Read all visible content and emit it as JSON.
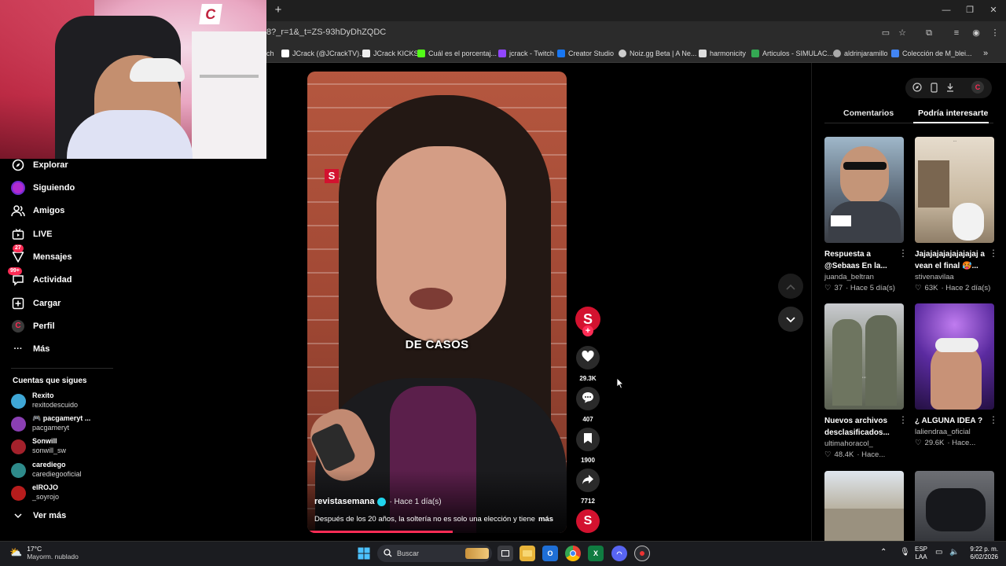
{
  "browser": {
    "url": "8?_r=1&_t=ZS-93hDyDhZQDC",
    "bookmarks": [
      {
        "label": "ch",
        "color": "#888888"
      },
      {
        "label": "JCrack (@JCrackTV)...",
        "color": "#ffffff"
      },
      {
        "label": "JCrack KICKS",
        "color": "#eeeeee"
      },
      {
        "label": "Cuál es el porcentaj...",
        "color": "#53fc18"
      },
      {
        "label": "jcrack - Twitch",
        "color": "#9146ff"
      },
      {
        "label": "Creator Studio",
        "color": "#1877f2"
      },
      {
        "label": "Noiz.gg Beta | A Ne...",
        "color": "#cccccc"
      },
      {
        "label": "harmonicity",
        "color": "#dddddd"
      },
      {
        "label": "Articulos - SIMULAC...",
        "color": "#34a853"
      },
      {
        "label": "aldrinjaramillo",
        "color": "#aaaaaa"
      },
      {
        "label": "Colección de M_blei...",
        "color": "#4285f4"
      }
    ]
  },
  "sidebar": {
    "items": [
      {
        "label": "Explorar",
        "badge": ""
      },
      {
        "label": "Siguiendo",
        "badge": ""
      },
      {
        "label": "Amigos",
        "badge": ""
      },
      {
        "label": "LIVE",
        "badge": ""
      },
      {
        "label": "Mensajes",
        "badge": "27"
      },
      {
        "label": "Actividad",
        "badge": "99+"
      },
      {
        "label": "Cargar",
        "badge": ""
      },
      {
        "label": "Perfil",
        "badge": ""
      },
      {
        "label": "Más",
        "badge": ""
      }
    ],
    "following_title": "Cuentas que sigues",
    "following": [
      {
        "name": "Rexito",
        "handle": "rexitodescuido",
        "color": "#3fa7d6"
      },
      {
        "name": "🎮 pacgameryt ...",
        "handle": "pacgameryt",
        "color": "#8a3fb3"
      },
      {
        "name": "Sonwill",
        "handle": "sonwill_sw",
        "color": "#a3212b"
      },
      {
        "name": "carediego",
        "handle": "carediegooficial",
        "color": "#2e8b8b"
      },
      {
        "name": "elROJO",
        "handle": "_soyrojo",
        "color": "#b71c1c"
      }
    ],
    "see_more": "Ver más"
  },
  "video": {
    "caption_overlay": "DE CASOS",
    "logo_letter": "S",
    "author": "revistasemana",
    "time": "· Hace 1 día(s)",
    "description": "Después de los 20 años, la soltería no es solo una elección y tiene",
    "more": "más",
    "progress": 0.56
  },
  "actions": {
    "avatar_letter": "S",
    "likes": "29.3K",
    "comments": "407",
    "saves": "1900",
    "shares": "7712"
  },
  "right_panel": {
    "tabs": [
      "Comentarios",
      "Podría interesarte"
    ],
    "active_tab": "Podría interesarte",
    "cards": [
      {
        "title": "Respuesta a @Sebaas En la...",
        "user": "juanda_beltran",
        "likes": "37",
        "time": "· Hace 5 día(s)"
      },
      {
        "title": "Jajajajajajajajajaj a vean el final 🥵...",
        "user": "stivenavilaa",
        "likes": "63K",
        "time": "· Hace 2 día(s)"
      },
      {
        "title": "Nuevos archivos desclasificados...",
        "user": "ultimahoracol_",
        "likes": "48.4K",
        "time": "· Hace..."
      },
      {
        "title": "¿ ALGUNA IDEA ?",
        "user": "laliendraa_oficial",
        "likes": "29.6K",
        "time": "· Hace..."
      },
      {
        "title": "",
        "user": "",
        "likes": "",
        "time": ""
      },
      {
        "title": "",
        "user": "",
        "likes": "",
        "time": ""
      }
    ]
  },
  "taskbar": {
    "temp": "17°C",
    "weather": "Mayorm. nublado",
    "search_placeholder": "Buscar",
    "lang1": "ESP",
    "lang2": "LAA",
    "time": "9:22 p. m.",
    "date": "6/02/2026"
  }
}
